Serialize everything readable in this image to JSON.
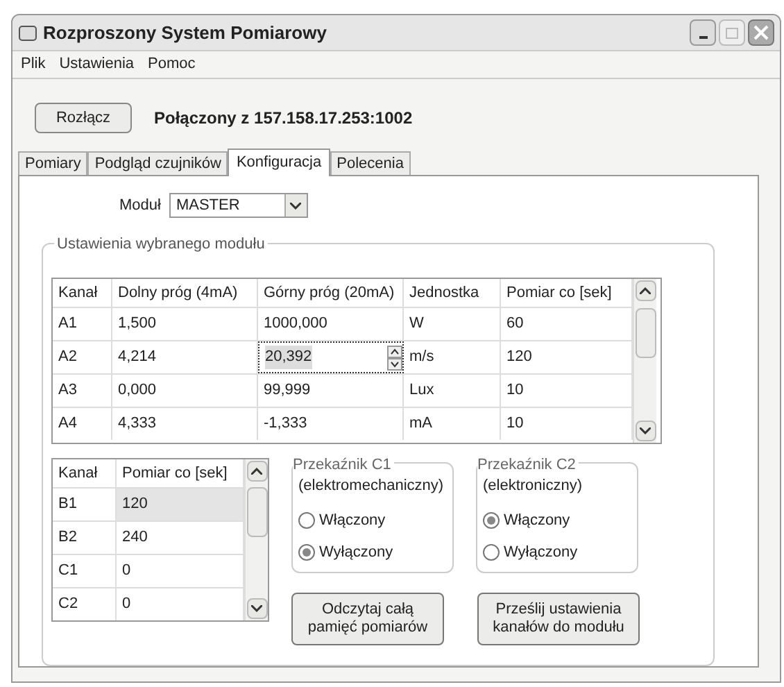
{
  "window": {
    "title": "Rozproszony System Pomiarowy"
  },
  "menu": [
    "Plik",
    "Ustawienia",
    "Pomoc"
  ],
  "disconnect_button": "Rozłącz",
  "status": "Połączony z 157.158.17.253:1002",
  "tabs": [
    {
      "label": "Pomiary",
      "selected": false
    },
    {
      "label": "Podgląd czujników",
      "selected": false
    },
    {
      "label": "Konfiguracja",
      "selected": true
    },
    {
      "label": "Polecenia",
      "selected": false
    }
  ],
  "module": {
    "label": "Moduł",
    "value": "MASTER"
  },
  "group": {
    "title": "Ustawienia wybranego modułu"
  },
  "table_a": {
    "columns": [
      "Kanał",
      "Dolny próg (4mA)",
      "Górny próg (20mA)",
      "Jednostka",
      "Pomiar co [sek]"
    ],
    "rows": [
      {
        "cells": [
          {
            "text": "A1",
            "editing": false
          },
          {
            "text": "1,500",
            "editing": false
          },
          {
            "text": "1000,000",
            "editing": false
          },
          {
            "text": "W",
            "editing": false
          },
          {
            "text": "60",
            "editing": false
          }
        ]
      },
      {
        "cells": [
          {
            "text": "A2",
            "editing": false
          },
          {
            "text": "4,214",
            "editing": false
          },
          {
            "text": "20,392",
            "editing": true
          },
          {
            "text": "m/s",
            "editing": false
          },
          {
            "text": "120",
            "editing": false
          }
        ]
      },
      {
        "cells": [
          {
            "text": "A3",
            "editing": false
          },
          {
            "text": "0,000",
            "editing": false
          },
          {
            "text": "99,999",
            "editing": false
          },
          {
            "text": "Lux",
            "editing": false
          },
          {
            "text": "10",
            "editing": false
          }
        ]
      },
      {
        "cells": [
          {
            "text": "A4",
            "editing": false
          },
          {
            "text": "4,333",
            "editing": false
          },
          {
            "text": "-1,333",
            "editing": false
          },
          {
            "text": "mA",
            "editing": false
          },
          {
            "text": "10",
            "editing": false
          }
        ]
      }
    ]
  },
  "table_b": {
    "columns": [
      "Kanał",
      "Pomiar co [sek]"
    ],
    "rows": [
      {
        "cells": [
          "B1",
          "120"
        ],
        "selected": true
      },
      {
        "cells": [
          "B2",
          "240"
        ],
        "selected": false
      },
      {
        "cells": [
          "C1",
          "0"
        ],
        "selected": false
      },
      {
        "cells": [
          "C2",
          "0"
        ],
        "selected": false
      }
    ]
  },
  "relays": [
    {
      "title": "Przekaźnik C1",
      "subtitle": "(elektromechaniczny)",
      "options": [
        {
          "label": "Włączony",
          "selected": false
        },
        {
          "label": "Wyłączony",
          "selected": true
        }
      ]
    },
    {
      "title": "Przekaźnik C2",
      "subtitle": "(elektroniczny)",
      "options": [
        {
          "label": "Włączony",
          "selected": true
        },
        {
          "label": "Wyłączony",
          "selected": false
        }
      ]
    }
  ],
  "buttons": [
    "Odczytaj całą pamięć pomiarów",
    "Prześlij ustawienia kanałów do modułu"
  ]
}
